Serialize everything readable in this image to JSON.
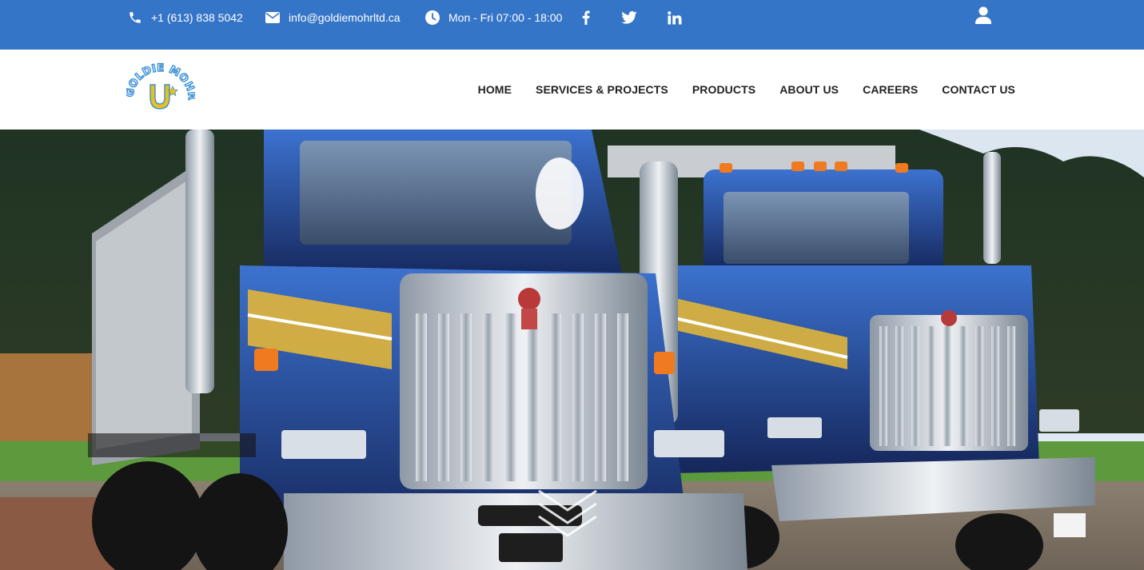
{
  "topbar": {
    "phone": "+1 (613) 838 5042",
    "email": "info@goldiemohrltd.ca",
    "hours": "Mon - Fri 07:00 - 18:00",
    "icons": {
      "phone": "phone-icon",
      "email": "envelope-icon",
      "hours": "clock-icon",
      "facebook": "facebook-icon",
      "twitter": "twitter-icon",
      "linkedin": "linkedin-icon",
      "user": "user-icon"
    },
    "background": "#3575c8"
  },
  "header": {
    "logo_text": "GOLDIE MOHR LTD",
    "nav": [
      {
        "label": "HOME"
      },
      {
        "label": "SERVICES & PROJECTS"
      },
      {
        "label": "PRODUCTS"
      },
      {
        "label": "ABOUT US"
      },
      {
        "label": "CAREERS"
      },
      {
        "label": "CONTACT US"
      }
    ]
  },
  "hero": {
    "scroll_icon": "double-chevron-down-icon"
  }
}
